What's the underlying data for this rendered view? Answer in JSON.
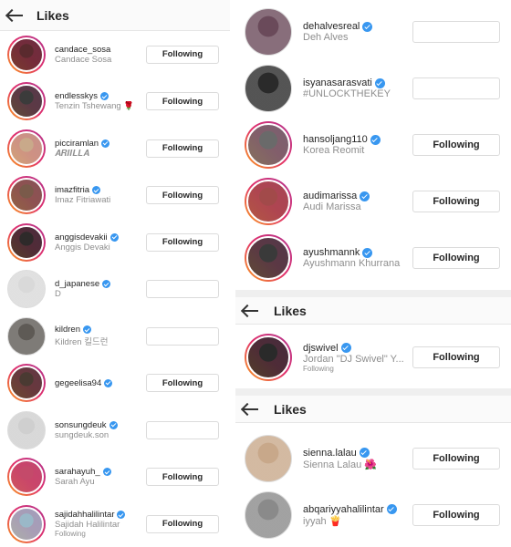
{
  "header": {
    "title": "Likes"
  },
  "button_label": "Following",
  "left_rows": [
    {
      "username": "candace_sosa",
      "display": "Candace Sosa",
      "verified": false,
      "button": "Following",
      "color": "#5a2a2e",
      "ring": true
    },
    {
      "username": "endlesskys",
      "display": "Tenzin Tshewang 🌹",
      "verified": true,
      "button": "Following",
      "color": "#3b3b3b",
      "ring": true
    },
    {
      "username": "picciramlan",
      "display": "𝑨𝑹𝑰𝑰𝑳𝑳𝑨",
      "verified": true,
      "button": "Following",
      "color": "#c9a98a",
      "ring": true
    },
    {
      "username": "imazfitria",
      "display": "Imaz Fitriawati",
      "verified": true,
      "button": "Following",
      "color": "#7a5a4a",
      "ring": true
    },
    {
      "username": "anggisdevakii",
      "display": "Anggis Devaki",
      "verified": true,
      "button": "Following",
      "color": "#2e2a2a",
      "ring": true
    },
    {
      "username": "d_japanese",
      "display": "D",
      "verified": true,
      "button": "",
      "color": "#d9d9d9",
      "ring": false
    },
    {
      "username": "kildren",
      "display": "Kildren 킬드런",
      "verified": true,
      "button": "",
      "color": "#5e5a55",
      "ring": false
    },
    {
      "username": "gegeelisa94",
      "display": "",
      "verified": true,
      "button": "Following",
      "color": "#4a3a32",
      "ring": true
    },
    {
      "username": "sonsungdeuk",
      "display": "sungdeuk.son",
      "verified": true,
      "button": "",
      "color": "#cfcfcf",
      "ring": false
    },
    {
      "username": "sarahayuh_",
      "display": "Sarah Ayu",
      "verified": true,
      "button": "Following",
      "color": "#c44a6a",
      "ring": true
    },
    {
      "username": "sajidahhalilintar",
      "display": "Sajidah Halilintar",
      "verified": true,
      "button": "Following",
      "sub": "Following",
      "color": "#9ab8c8",
      "ring": true
    }
  ],
  "right_top_rows": [
    {
      "username": "dehalvesreal",
      "display": "Deh Alves",
      "verified": true,
      "button": "",
      "color": "#6a4a5a",
      "ring": false
    },
    {
      "username": "isyanasarasvati",
      "display": "#UNLOCKTHEKEY",
      "verified": true,
      "button": "",
      "color": "#2a2a2a",
      "ring": false
    },
    {
      "username": "hansoljang110",
      "display": "Korea Reomit",
      "verified": true,
      "button": "Following",
      "color": "#6a6a6a",
      "ring": true
    },
    {
      "username": "audimarissa",
      "display": "Audi Marissa",
      "verified": true,
      "button": "Following",
      "color": "#a24a4a",
      "ring": true
    },
    {
      "username": "ayushmannk",
      "display": "Ayushmann Khurrana",
      "verified": true,
      "button": "Following",
      "color": "#3a3a3a",
      "ring": true
    }
  ],
  "right_mid_rows": [
    {
      "username": "djswivel",
      "display": "Jordan \"DJ Swivel\" Y...",
      "verified": true,
      "button": "Following",
      "sub": "Following",
      "color": "#2a2a2a",
      "ring": true
    }
  ],
  "right_bottom_rows": [
    {
      "username": "sienna.lalau",
      "display": "Sienna Lalau 🌺",
      "verified": true,
      "button": "Following",
      "color": "#c8a88a",
      "ring": false
    },
    {
      "username": "abqariyyahalilintar",
      "display": "iyyah 🍟",
      "verified": true,
      "button": "Following",
      "color": "#8a8a8a",
      "ring": false
    }
  ]
}
